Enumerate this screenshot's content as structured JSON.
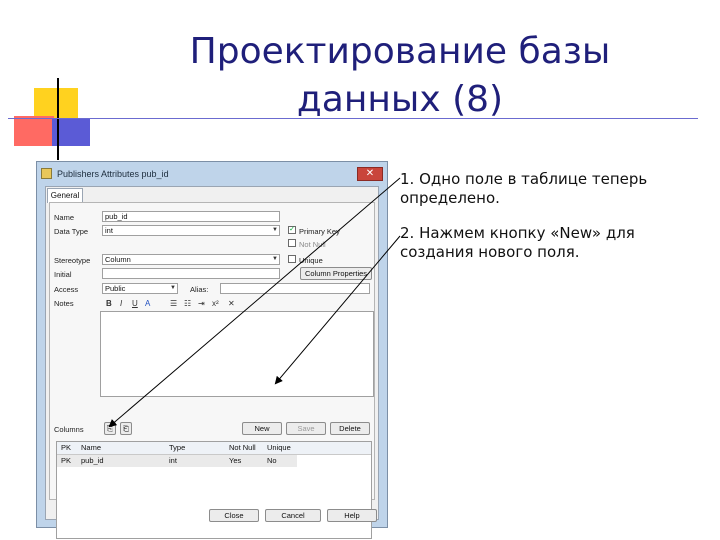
{
  "slide": {
    "title_line1": "Проектирование базы",
    "title_line2": "данных (8)",
    "notes": [
      "1. Одно поле в таблице теперь определено.",
      "2. Нажмем кнопку «New» для создания нового поля."
    ]
  },
  "dialog": {
    "title": "Publishers Attributes  pub_id",
    "close_icon": "close-icon",
    "tab_general": "General",
    "labels": {
      "name": "Name",
      "data_type": "Data Type",
      "stereotype": "Stereotype",
      "initial": "Initial",
      "access": "Access",
      "alias": "Alias:",
      "notes": "Notes",
      "columns": "Columns"
    },
    "fields": {
      "name_value": "pub_id",
      "data_type_value": "int",
      "stereotype_value": "Column",
      "initial_value": "",
      "access_value": "Public",
      "alias_value": ""
    },
    "checkboxes": {
      "primary_key": "Primary Key",
      "not_null": "Not Null",
      "unique": "Unique",
      "primary_key_checked": true
    },
    "column_properties_button": "Column Properties",
    "toolbar": {
      "bold": "B",
      "italic": "I",
      "underline": "U",
      "font_color": "A",
      "superscript": "x²",
      "close": "✕"
    },
    "buttons": {
      "new": "New",
      "save": "Save",
      "delete": "Delete",
      "close": "Close",
      "cancel": "Cancel",
      "help": "Help"
    },
    "grid": {
      "headers": [
        "PK",
        "Name",
        "Type",
        "Not Null",
        "Unique"
      ],
      "rows": [
        [
          "PK",
          "pub_id",
          "int",
          "Yes",
          "No"
        ]
      ]
    }
  },
  "colors": {
    "title": "#1f1f7a",
    "accent_yellow": "#ffd21f",
    "accent_red": "#ff6a63",
    "accent_blue": "#5b5bd6"
  }
}
